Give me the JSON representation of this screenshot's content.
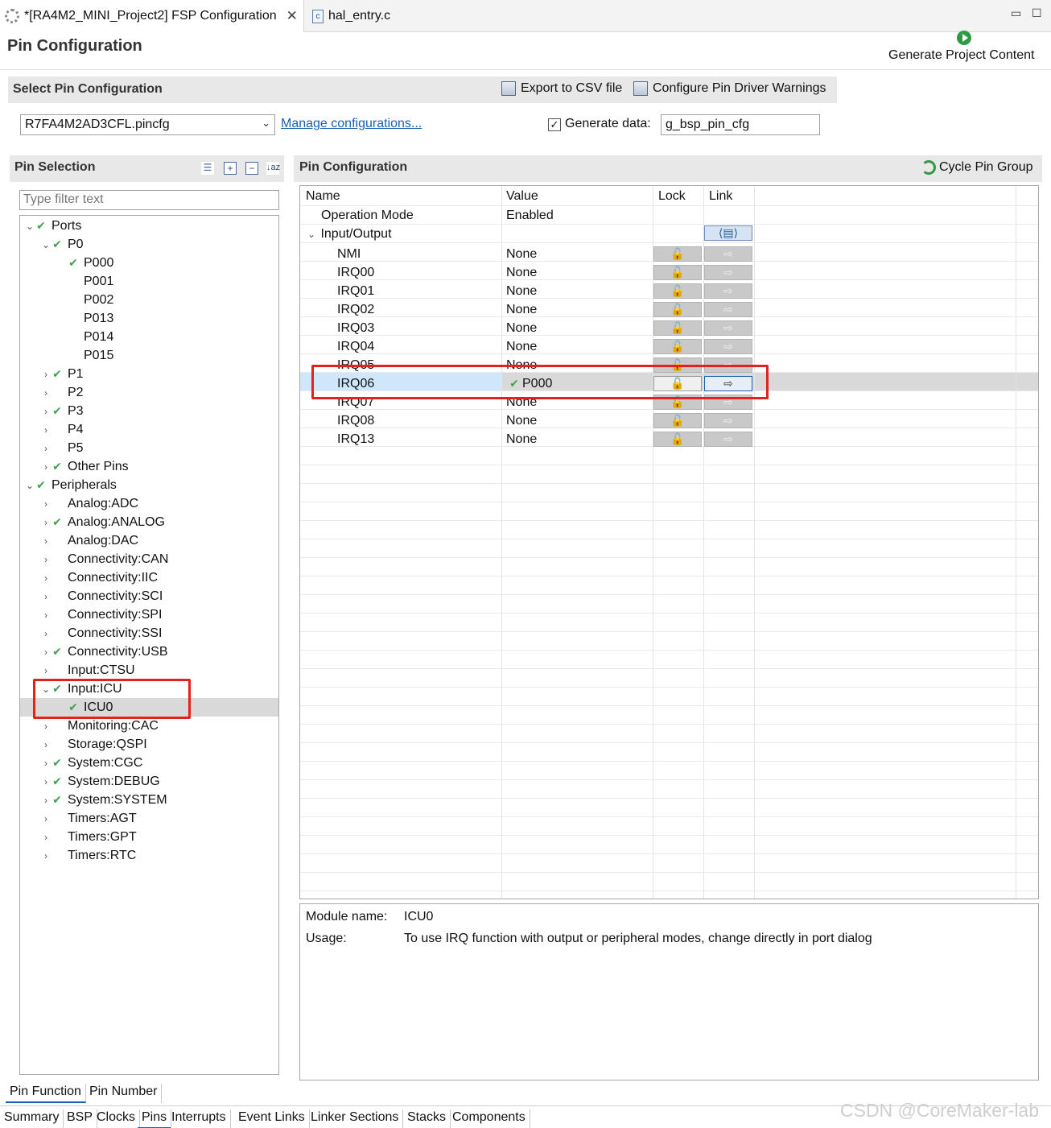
{
  "tabs": [
    {
      "label": "*[RA4M2_MINI_Project2] FSP Configuration"
    },
    {
      "label": "hal_entry.c",
      "icon_letter": "c"
    }
  ],
  "page_title": "Pin Configuration",
  "generate_button": "Generate Project Content",
  "select_pin_config": {
    "title": "Select Pin Configuration",
    "export_label": "Export to CSV file",
    "warnings_label": "Configure Pin Driver Warnings",
    "selected_file": "R7FA4M2AD3CFL.pincfg",
    "manage_link": "Manage configurations...",
    "generate_data_label": "Generate data:",
    "generate_data_checked": true,
    "generate_data_value": "g_bsp_pin_cfg"
  },
  "pin_selection": {
    "title": "Pin Selection",
    "filter_placeholder": "Type filter text",
    "tree": [
      {
        "label": "Ports",
        "twisty": "open",
        "check": true
      },
      {
        "label": "P0",
        "twisty": "open",
        "check": true
      },
      {
        "label": "P000",
        "twisty": "",
        "check": true
      },
      {
        "label": "P001",
        "twisty": "",
        "check": false
      },
      {
        "label": "P002",
        "twisty": "",
        "check": false
      },
      {
        "label": "P013",
        "twisty": "",
        "check": false
      },
      {
        "label": "P014",
        "twisty": "",
        "check": false
      },
      {
        "label": "P015",
        "twisty": "",
        "check": false
      },
      {
        "label": "P1",
        "twisty": "closed",
        "check": true
      },
      {
        "label": "P2",
        "twisty": "closed",
        "check": false
      },
      {
        "label": "P3",
        "twisty": "closed",
        "check": true
      },
      {
        "label": "P4",
        "twisty": "closed",
        "check": false
      },
      {
        "label": "P5",
        "twisty": "closed",
        "check": false
      },
      {
        "label": "Other Pins",
        "twisty": "closed",
        "check": true
      },
      {
        "label": "Peripherals",
        "twisty": "open",
        "check": true
      },
      {
        "label": "Analog:ADC",
        "twisty": "closed",
        "check": false
      },
      {
        "label": "Analog:ANALOG",
        "twisty": "closed",
        "check": true
      },
      {
        "label": "Analog:DAC",
        "twisty": "closed",
        "check": false
      },
      {
        "label": "Connectivity:CAN",
        "twisty": "closed",
        "check": false
      },
      {
        "label": "Connectivity:IIC",
        "twisty": "closed",
        "check": false
      },
      {
        "label": "Connectivity:SCI",
        "twisty": "closed",
        "check": false
      },
      {
        "label": "Connectivity:SPI",
        "twisty": "closed",
        "check": false
      },
      {
        "label": "Connectivity:SSI",
        "twisty": "closed",
        "check": false
      },
      {
        "label": "Connectivity:USB",
        "twisty": "closed",
        "check": true
      },
      {
        "label": "Input:CTSU",
        "twisty": "closed",
        "check": false
      },
      {
        "label": "Input:ICU",
        "twisty": "open",
        "check": true
      },
      {
        "label": "ICU0",
        "twisty": "",
        "check": true
      },
      {
        "label": "Monitoring:CAC",
        "twisty": "closed",
        "check": false
      },
      {
        "label": "Storage:QSPI",
        "twisty": "closed",
        "check": false
      },
      {
        "label": "System:CGC",
        "twisty": "closed",
        "check": true
      },
      {
        "label": "System:DEBUG",
        "twisty": "closed",
        "check": true
      },
      {
        "label": "System:SYSTEM",
        "twisty": "closed",
        "check": true
      },
      {
        "label": "Timers:AGT",
        "twisty": "closed",
        "check": false
      },
      {
        "label": "Timers:GPT",
        "twisty": "closed",
        "check": false
      },
      {
        "label": "Timers:RTC",
        "twisty": "closed",
        "check": false
      }
    ],
    "selected": "ICU0"
  },
  "pin_config": {
    "title": "Pin Configuration",
    "cycle_label": "Cycle Pin Group",
    "columns": [
      "Name",
      "Value",
      "Lock",
      "Link"
    ],
    "operation_mode": {
      "name": "Operation Mode",
      "value": "Enabled"
    },
    "group": "Input/Output",
    "rows": [
      {
        "name": "NMI",
        "value": "None"
      },
      {
        "name": "IRQ00",
        "value": "None"
      },
      {
        "name": "IRQ01",
        "value": "None"
      },
      {
        "name": "IRQ02",
        "value": "None"
      },
      {
        "name": "IRQ03",
        "value": "None"
      },
      {
        "name": "IRQ04",
        "value": "None"
      },
      {
        "name": "IRQ05",
        "value": "None"
      },
      {
        "name": "IRQ06",
        "value": "P000",
        "selected": true
      },
      {
        "name": "IRQ07",
        "value": "None"
      },
      {
        "name": "IRQ08",
        "value": "None"
      },
      {
        "name": "IRQ13",
        "value": "None"
      }
    ]
  },
  "info": {
    "module_label": "Module name:",
    "module_value": "ICU0",
    "usage_label": "Usage:",
    "usage_value": "To use IRQ function with output or peripheral modes, change directly in port dialog"
  },
  "pin_tabs": [
    "Pin Function",
    "Pin Number"
  ],
  "bottom_tabs": [
    "Summary",
    "BSP",
    "Clocks",
    "Pins",
    "Interrupts",
    "Event Links",
    "Linker Sections",
    "Stacks",
    "Components"
  ],
  "active_bottom_tab": "Pins",
  "watermark": "CSDN @CoreMaker-lab",
  "colors": {
    "accent": "#1a5fb4",
    "highlight": "#e3231b",
    "check": "#3fa34d"
  }
}
